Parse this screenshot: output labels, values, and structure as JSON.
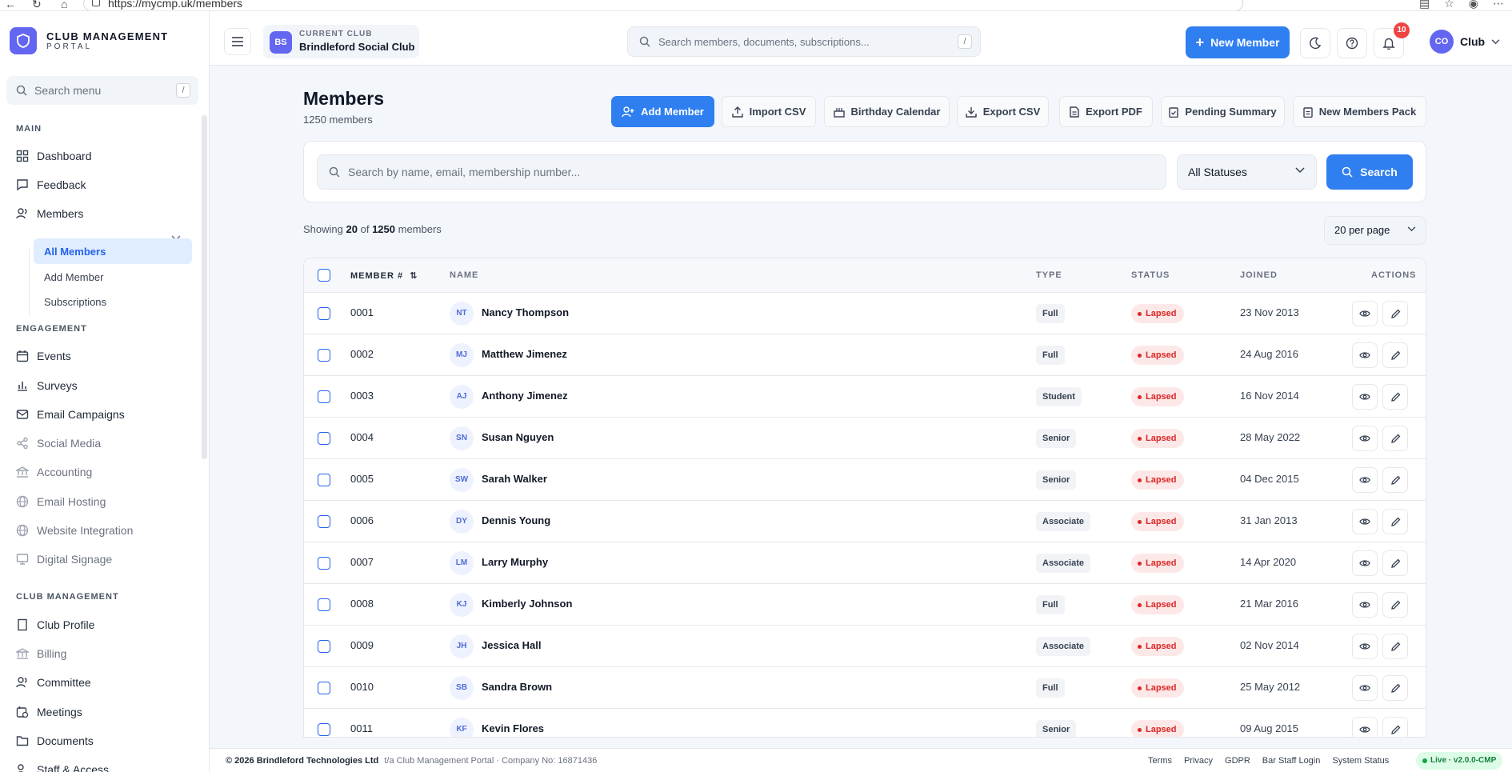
{
  "browser": {
    "url": "https://mycmp.uk/members"
  },
  "brand": {
    "title": "CLUB MANAGEMENT",
    "subtitle": "PORTAL"
  },
  "sidebar": {
    "search_placeholder": "Search menu",
    "search_shortcut": "/",
    "sections": {
      "main": "MAIN",
      "engagement": "ENGAGEMENT",
      "club": "CLUB MANAGEMENT"
    },
    "items": {
      "dashboard": "Dashboard",
      "feedback": "Feedback",
      "members": "Members",
      "all_members": "All Members",
      "add_member": "Add Member",
      "subscriptions": "Subscriptions",
      "events": "Events",
      "surveys": "Surveys",
      "email_campaigns": "Email Campaigns",
      "social_media": "Social Media",
      "accounting": "Accounting",
      "email_hosting": "Email Hosting",
      "website_integration": "Website Integration",
      "digital_signage": "Digital Signage",
      "club_profile": "Club Profile",
      "billing": "Billing",
      "committee": "Committee",
      "meetings": "Meetings",
      "documents": "Documents",
      "staff_access": "Staff & Access"
    }
  },
  "topbar": {
    "club_initials": "BS",
    "club_label": "CURRENT CLUB",
    "club_name": "Brindleford Social Club",
    "search_placeholder": "Search members, documents, subscriptions...",
    "search_shortcut": "/",
    "new_member": "New Member",
    "notif_count": "10",
    "user_initials": "CO",
    "user_name": "Club"
  },
  "page": {
    "title": "Members",
    "subtitle": "1250 members",
    "actions": {
      "add_member": "Add Member",
      "import_csv": "Import CSV",
      "birthday_calendar": "Birthday Calendar",
      "export_csv": "Export CSV",
      "export_pdf": "Export PDF",
      "pending_summary": "Pending Summary",
      "new_members_pack": "New Members Pack"
    }
  },
  "filter": {
    "placeholder": "Search by name, email, membership number...",
    "status_value": "All Statuses",
    "search_button": "Search"
  },
  "listing": {
    "showing_prefix": "Showing",
    "showing_count": "20",
    "showing_of": "of",
    "showing_total": "1250",
    "showing_suffix": "members",
    "per_page": "20 per page"
  },
  "table": {
    "headers": {
      "member": "MEMBER #",
      "name": "NAME",
      "type": "TYPE",
      "status": "STATUS",
      "joined": "JOINED",
      "actions": "ACTIONS"
    },
    "rows": [
      {
        "num": "0001",
        "initials": "NT",
        "name": "Nancy Thompson",
        "type": "Full",
        "status": "Lapsed",
        "joined": "23 Nov 2013"
      },
      {
        "num": "0002",
        "initials": "MJ",
        "name": "Matthew Jimenez",
        "type": "Full",
        "status": "Lapsed",
        "joined": "24 Aug 2016"
      },
      {
        "num": "0003",
        "initials": "AJ",
        "name": "Anthony Jimenez",
        "type": "Student",
        "status": "Lapsed",
        "joined": "16 Nov 2014"
      },
      {
        "num": "0004",
        "initials": "SN",
        "name": "Susan Nguyen",
        "type": "Senior",
        "status": "Lapsed",
        "joined": "28 May 2022"
      },
      {
        "num": "0005",
        "initials": "SW",
        "name": "Sarah Walker",
        "type": "Senior",
        "status": "Lapsed",
        "joined": "04 Dec 2015"
      },
      {
        "num": "0006",
        "initials": "DY",
        "name": "Dennis Young",
        "type": "Associate",
        "status": "Lapsed",
        "joined": "31 Jan 2013"
      },
      {
        "num": "0007",
        "initials": "LM",
        "name": "Larry Murphy",
        "type": "Associate",
        "status": "Lapsed",
        "joined": "14 Apr 2020"
      },
      {
        "num": "0008",
        "initials": "KJ",
        "name": "Kimberly Johnson",
        "type": "Full",
        "status": "Lapsed",
        "joined": "21 Mar 2016"
      },
      {
        "num": "0009",
        "initials": "JH",
        "name": "Jessica Hall",
        "type": "Associate",
        "status": "Lapsed",
        "joined": "02 Nov 2014"
      },
      {
        "num": "0010",
        "initials": "SB",
        "name": "Sandra Brown",
        "type": "Full",
        "status": "Lapsed",
        "joined": "25 May 2012"
      },
      {
        "num": "0011",
        "initials": "KF",
        "name": "Kevin Flores",
        "type": "Senior",
        "status": "Lapsed",
        "joined": "09 Aug 2015"
      }
    ]
  },
  "footer": {
    "copyright": "© 2026 Brindleford Technologies Ltd",
    "company": "t/a Club Management Portal · Company No: 16871436",
    "links": {
      "terms": "Terms",
      "privacy": "Privacy",
      "gdpr": "GDPR",
      "bar_staff": "Bar Staff Login",
      "system_status": "System Status"
    },
    "live": "Live · v2.0.0-CMP"
  },
  "colors": {
    "accent": "#2f7ff0",
    "brand": "#6366f1",
    "lapsed": "#dc2626"
  }
}
